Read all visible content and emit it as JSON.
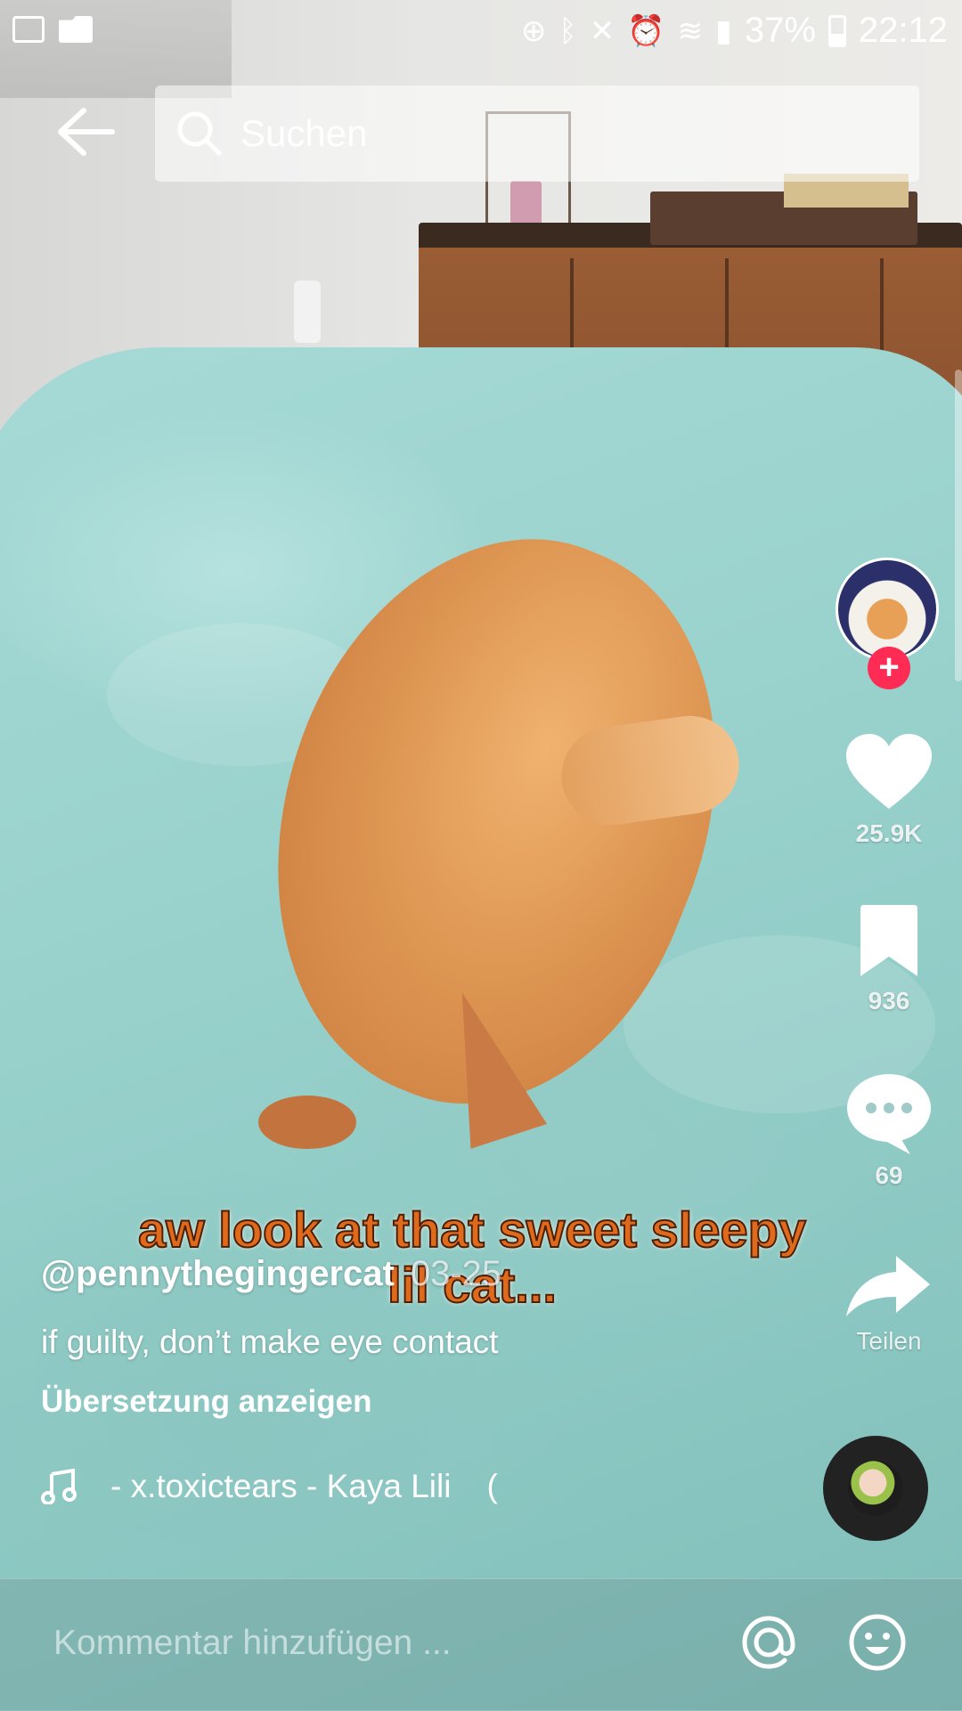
{
  "status_bar": {
    "battery_percent": "37%",
    "time": "22:12",
    "icons": [
      "image-icon",
      "folder-icon",
      "battery-saver-icon",
      "bluetooth-icon",
      "mute-icon",
      "alarm-icon",
      "wifi-icon",
      "signal-icon",
      "battery-icon"
    ]
  },
  "header": {
    "back_icon": "arrow-left-icon",
    "search_placeholder": "Suchen",
    "search_icon": "search-icon"
  },
  "video": {
    "overlay_caption_line1": "aw look at that sweet sleepy",
    "overlay_caption_line2": "lil cat..."
  },
  "actions": {
    "follow_label": "+",
    "like_count": "25.9K",
    "save_count": "936",
    "comment_count": "69",
    "share_label": "Teilen"
  },
  "post": {
    "username": "@pennythegingercat",
    "date": "03-25",
    "description": "if guilty, don’t make eye contact",
    "translate_label": "Übersetzung anzeigen",
    "music": "- x.toxictears - Kaya Lili",
    "music_cut": "("
  },
  "comment_bar": {
    "placeholder": "Kommentar hinzufügen ...",
    "mention_icon": "at-sign-icon",
    "emoji_icon": "emoji-icon"
  },
  "colors": {
    "accent": "#fe2c55",
    "caption_text": "#e06a1c"
  }
}
